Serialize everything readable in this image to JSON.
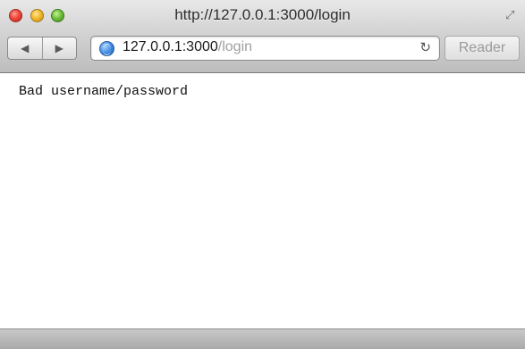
{
  "window": {
    "title": "http://127.0.0.1:3000/login"
  },
  "toolbar": {
    "back_icon": "◀",
    "forward_icon": "▶",
    "url_host": "127.0.0.1:3000",
    "url_path": "/login",
    "reload_icon": "↻",
    "reader_label": "Reader"
  },
  "page": {
    "message": "Bad username/password"
  }
}
